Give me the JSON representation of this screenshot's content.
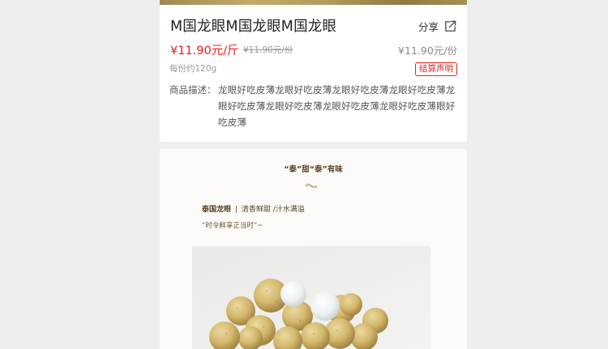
{
  "product": {
    "title": "M国龙眼M国龙眼M国龙眼",
    "share_label": "分享",
    "price_main": "¥11.90元/斤",
    "price_original": "¥11.90元/份",
    "price_per_portion": "¥11.90元/份",
    "weight_note": "每份约120g",
    "settlement_badge": "结算声明",
    "description_label": "商品描述：",
    "description_text": "龙眼好吃皮薄龙眼好吃皮薄龙眼好吃皮薄龙眼好吃皮薄龙眼好吃皮薄龙眼好吃皮薄龙眼好吃皮薄龙眼好吃皮薄眼好吃皮薄"
  },
  "detail": {
    "tagline": "“泰”甜“泰”有味",
    "intro_name": "泰国龙眼",
    "intro_separator": "|",
    "intro_desc": "清香鲜甜 /汁水满溢",
    "slogan": "“时令鲜享正当时”~"
  },
  "icons": {
    "share": "share-icon",
    "ornament": "ornament-icon"
  },
  "colors": {
    "price_red": "#e8211b",
    "title_text": "#222222",
    "brown_text": "#5a4426",
    "page_background": "#eeeeee"
  }
}
